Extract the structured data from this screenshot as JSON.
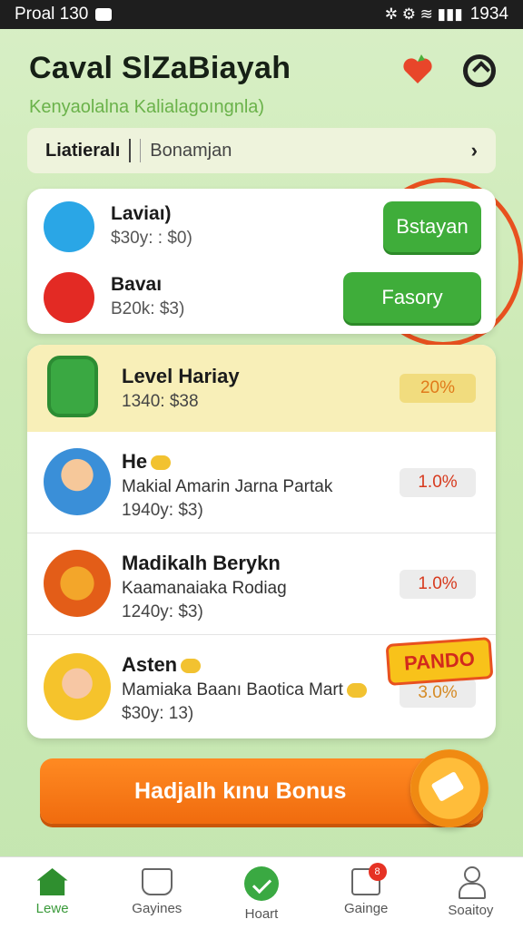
{
  "status_bar": {
    "left_text": "Proal 130",
    "right_text": "1934"
  },
  "header": {
    "title": "Caval SlZaBiayah",
    "subtitle": "Kenyaolalna Kalialagoıngnla)"
  },
  "search": {
    "left_label": "Liatieralı",
    "right_label": "Bonamjan"
  },
  "apps": [
    {
      "name": "Laviaı)",
      "meta": "$30y: : $0)",
      "button_label": "Bstayan",
      "logo": "blue-s-logo"
    },
    {
      "name": "Bavaı",
      "meta": "B20k: $3)",
      "button_label": "Fasory",
      "logo": "red-play-logo"
    }
  ],
  "rewards": [
    {
      "title": "Level Hariay",
      "meta": "1340: $38",
      "badge": "20%"
    },
    {
      "title": "He",
      "desc": "Makial Amarin Jarna Partak",
      "meta": "1940y: $3)",
      "badge": "1.0%"
    },
    {
      "title": "Madikalh Berykn",
      "desc": "Kaamanaiaka Rodiag",
      "meta": "1240y: $3)",
      "badge": "1.0%"
    },
    {
      "title": "Asten",
      "desc": "Mamiaka Baanı Baotica Mart",
      "meta": "$30y: 13)",
      "badge": "3.0%"
    }
  ],
  "promo_tag": "PANDO",
  "bonus_button": {
    "label": "Hadjalh kınu Bonus"
  },
  "nav": [
    {
      "label": "Lewe",
      "icon": "home-icon",
      "active": true
    },
    {
      "label": "Gayines",
      "icon": "games-icon"
    },
    {
      "label": "Hoart",
      "icon": "heart-check-icon"
    },
    {
      "label": "Gainge",
      "icon": "gift-icon",
      "badge": "8"
    },
    {
      "label": "Soaitoy",
      "icon": "profile-icon"
    }
  ],
  "colors": {
    "accent_green": "#3fad3a",
    "accent_orange": "#f06b0e",
    "badge_red": "#d73a1e",
    "highlight_yellow": "#f8efb8"
  }
}
